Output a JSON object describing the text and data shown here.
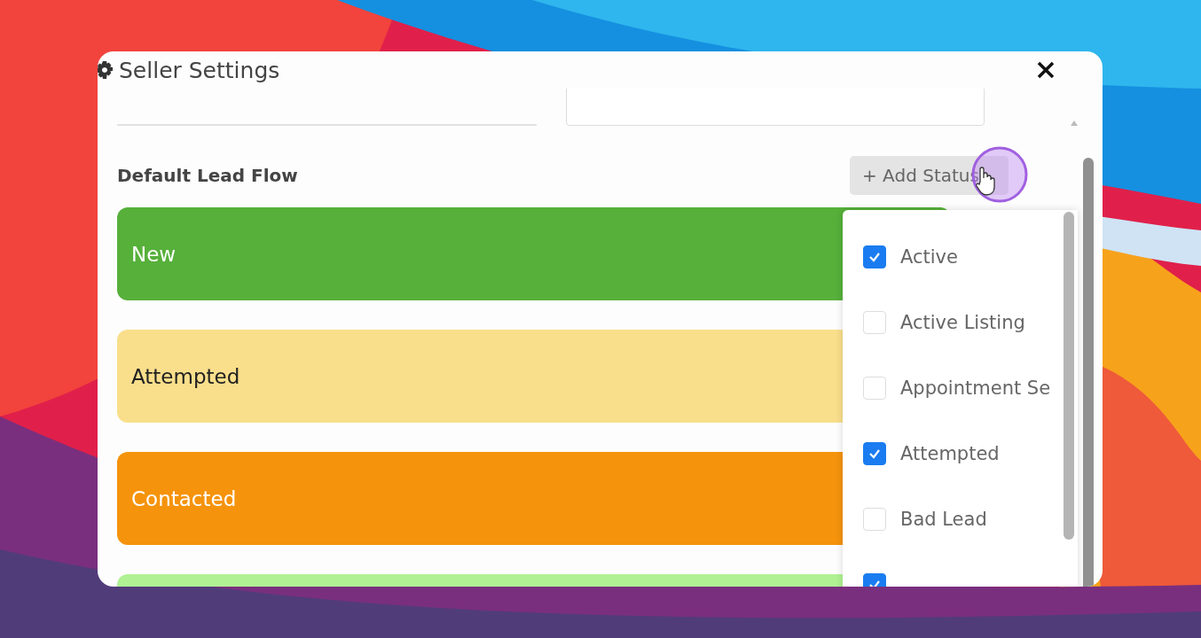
{
  "dialog": {
    "title": "Seller Settings"
  },
  "section": {
    "heading": "Default Lead Flow",
    "add_button": "+ Add Status"
  },
  "statuses": [
    {
      "label": "New",
      "color": "#56b03a"
    },
    {
      "label": "Attempted",
      "color": "#f9df8b"
    },
    {
      "label": "Contacted",
      "color": "#f5930c"
    },
    {
      "color": "#b0f293"
    }
  ],
  "dropdown": {
    "items": [
      {
        "label": "Active",
        "checked": true
      },
      {
        "label": "Active Listing",
        "checked": false
      },
      {
        "label": "Appointment Se",
        "checked": false
      },
      {
        "label": "Attempted",
        "checked": true
      },
      {
        "label": "Bad Lead",
        "checked": false
      },
      {
        "checked": true
      }
    ]
  }
}
